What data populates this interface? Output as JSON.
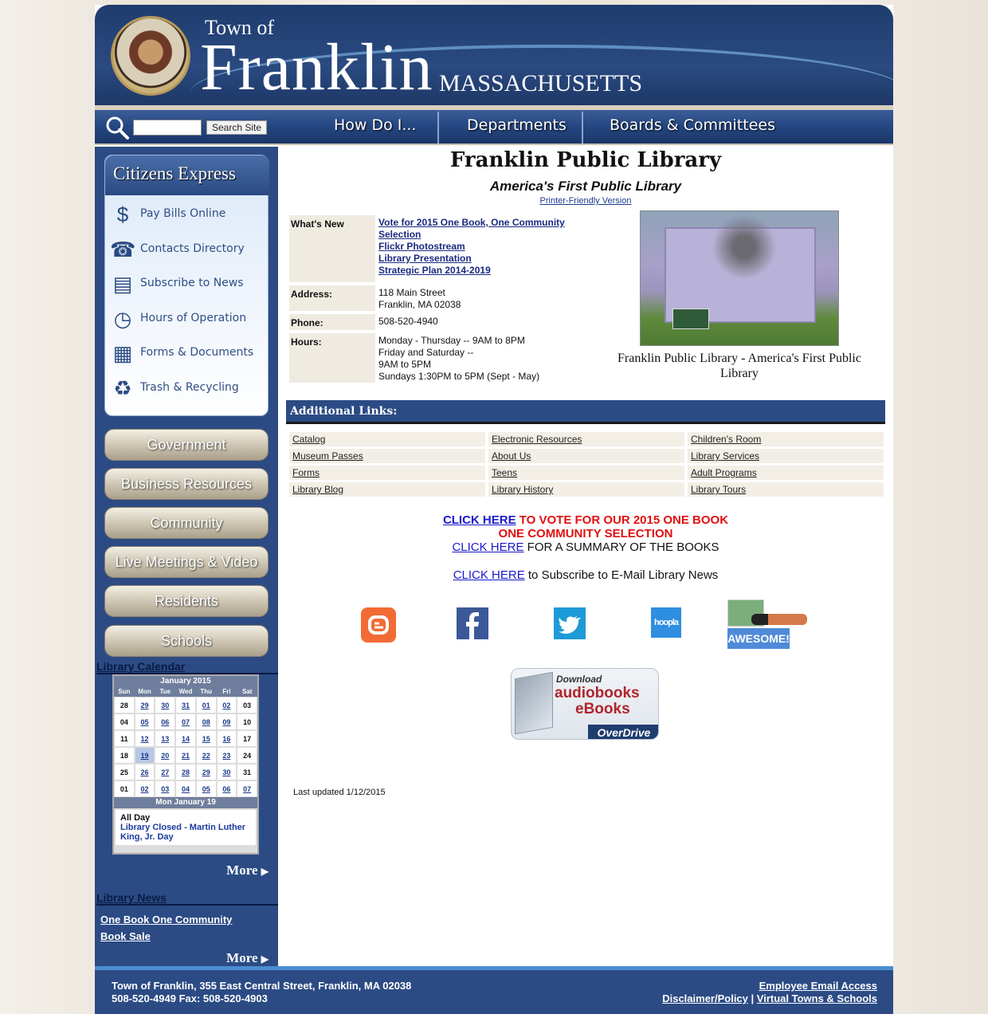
{
  "header": {
    "town_of": "Town of",
    "franklin": "Franklin",
    "state": "MASSACHUSETTS"
  },
  "search": {
    "value": "",
    "button": "Search Site"
  },
  "nav": {
    "how_do_i": "How Do I...",
    "departments": "Departments",
    "boards": "Boards & Committees"
  },
  "citizens_express": {
    "title": "Citizens Express",
    "items": [
      {
        "label": "Pay Bills Online",
        "icon": "dollar-icon"
      },
      {
        "label": "Contacts Directory",
        "icon": "phone-icon"
      },
      {
        "label": "Subscribe to News",
        "icon": "newspaper-icon"
      },
      {
        "label": "Hours of Operation",
        "icon": "clock-icon"
      },
      {
        "label": "Forms & Documents",
        "icon": "document-icon"
      },
      {
        "label": "Trash & Recycling",
        "icon": "recycle-icon"
      }
    ]
  },
  "side_buttons": [
    "Government",
    "Business Resources",
    "Community",
    "Live Meetings & Video",
    "Residents",
    "Schools"
  ],
  "calendar": {
    "heading": "Library Calendar",
    "month": "January 2015",
    "days": [
      "Sun",
      "Mon",
      "Tue",
      "Wed",
      "Thu",
      "Fri",
      "Sat"
    ],
    "weeks": [
      [
        "28",
        "29",
        "30",
        "31",
        "01",
        "02",
        "03"
      ],
      [
        "04",
        "05",
        "06",
        "07",
        "08",
        "09",
        "10"
      ],
      [
        "11",
        "12",
        "13",
        "14",
        "15",
        "16",
        "17"
      ],
      [
        "18",
        "19",
        "20",
        "21",
        "22",
        "23",
        "24"
      ],
      [
        "25",
        "26",
        "27",
        "28",
        "29",
        "30",
        "31"
      ],
      [
        "01",
        "02",
        "03",
        "04",
        "05",
        "06",
        "07"
      ]
    ],
    "selected_label": "Mon January 19",
    "event_time": "All Day",
    "event_title": "Library Closed - Martin Luther King, Jr. Day",
    "more": "More"
  },
  "news": {
    "heading": "Library News",
    "items": [
      "One Book One Community",
      "Book Sale"
    ],
    "more": "More"
  },
  "main": {
    "title": "Franklin Public Library",
    "subtitle": "America's First Public Library",
    "printer": "Printer-Friendly Version",
    "whats_new_label": "What's New",
    "whats_new_links": [
      "Vote for 2015 One Book, One Community Selection",
      "Flickr Photostream",
      "Library Presentation",
      "Strategic Plan 2014-2019"
    ],
    "address_label": "Address:",
    "address_lines": [
      "118 Main Street",
      "Franklin, MA 02038"
    ],
    "phone_label": "Phone:",
    "phone": "508-520-4940",
    "hours_label": "Hours:",
    "hours_lines": [
      "Monday - Thursday -- 9AM to 8PM",
      "Friday and Saturday --",
      "9AM to 5PM",
      "Sundays 1:30PM to 5PM (Sept - May)"
    ],
    "photo_caption": "Franklin Public Library - America's First Public Library",
    "additional_links_title": "Additional Links:",
    "links": [
      "Catalog",
      "Electronic Resources",
      "Children's Room",
      "Museum Passes",
      "About Us",
      "Library Services",
      "Forms",
      "Teens",
      "Adult Programs",
      "Library Blog",
      "Library History",
      "Library Tours"
    ],
    "cta1_link": "CLICK HERE",
    "cta1_text": " TO VOTE FOR OUR 2015 ONE BOOK",
    "cta1_text2": "ONE COMMUNITY SELECTION",
    "cta2_link": "CLICK HERE",
    "cta2_text": " FOR A SUMMARY OF THE BOOKS",
    "cta3_link": "CLICK HERE",
    "cta3_text": " to Subscribe to E-Mail Library News",
    "hoopla": "hoopla",
    "awesome": "AWESOME!",
    "od_download": "Download",
    "od_audiobooks": "audiobooks",
    "od_ebooks": "eBooks",
    "od_brand": "OverDrive",
    "last_updated": "Last updated 1/12/2015"
  },
  "footer": {
    "address": "Town of Franklin, 355 East Central Street, Franklin, MA 02038",
    "phones": "508-520-4949 Fax: 508-520-4903",
    "email": "Employee Email Access",
    "disclaimer": "Disclaimer/Policy",
    "separator": "|",
    "virtual": "Virtual Towns & Schools"
  },
  "colors": {
    "brand_blue": "#2c4b84",
    "header_blue": "#1f3c6e",
    "cta_red": "#e01010",
    "link_blue": "#1a18cc"
  }
}
